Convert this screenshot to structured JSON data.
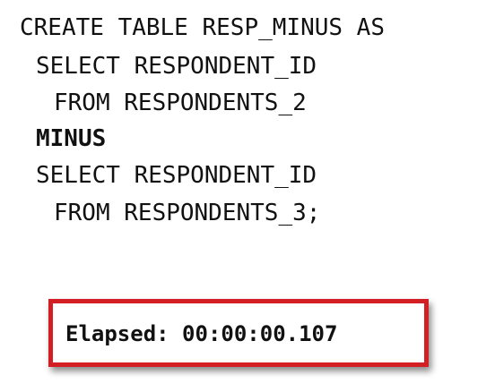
{
  "sql": {
    "lines": [
      "CREATE TABLE RESP_MINUS AS",
      "SELECT RESPONDENT_ID",
      "FROM RESPONDENTS_2",
      "MINUS",
      "SELECT RESPONDENT_ID",
      "FROM RESPONDENTS_3;"
    ]
  },
  "result": {
    "elapsed": "Elapsed: 00:00:00.107",
    "highlight_color": "#d21f23"
  }
}
